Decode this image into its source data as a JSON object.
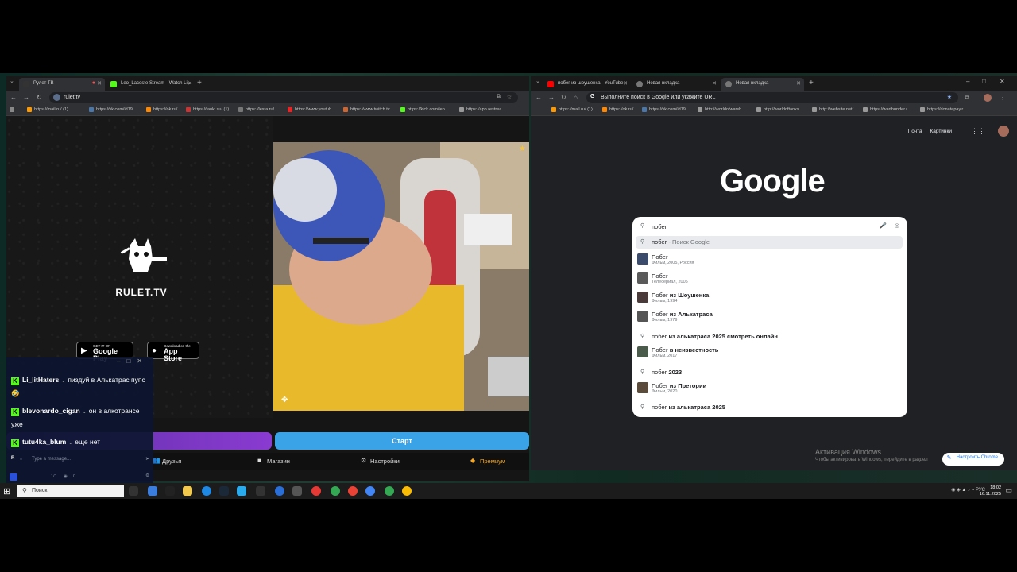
{
  "left_browser": {
    "tabs": [
      {
        "title": "Рулет ТВ",
        "active": true
      },
      {
        "title": "Leo_Lacoste Stream - Watch Li…",
        "active": false
      }
    ],
    "url": "rulet.tv",
    "bookmarks": [
      "https://mail.ru/ (1)",
      "https://vk.com/id19…",
      "https://ok.ru/",
      "https://tanki.su/ (1)",
      "https://lesta.ru/…",
      "https://www.youtub…",
      "https://www.twitch.tv…",
      "https://kick.com/leo…",
      "https://app.restrea…"
    ]
  },
  "rulet": {
    "brand": "RULET.TV",
    "google_play_small": "GET IT ON",
    "google_play_big": "Google Play",
    "app_store_small": "Download on the",
    "app_store_big": "App Store",
    "start_label": "Старт",
    "nav": {
      "friends": "Друзья",
      "shop": "Магазин",
      "settings": "Настройки",
      "premium": "Премиум"
    }
  },
  "chat": {
    "messages": [
      {
        "user": "Li_litHaters",
        "text": "пиздуй в Алькатрас пупс 🤣"
      },
      {
        "user": "blevonardo_cigan",
        "text": "он в алкотрансе уже"
      },
      {
        "user": "tutu4ka_blum",
        "text": "еще нет"
      }
    ],
    "input_avatar": "R",
    "input_placeholder": "Type a message...",
    "viewers": "1/1",
    "watchers": "0"
  },
  "right_browser": {
    "tabs": [
      {
        "title": "побег из шоушенка - YouTube",
        "active": false
      },
      {
        "title": "Новая вкладка",
        "active": false
      },
      {
        "title": "Новая вкладка",
        "active": true
      }
    ],
    "omnibox_placeholder": "Выполните поиск в Google или укажите URL",
    "bookmarks": [
      "https://mail.ru/ (1)",
      "https://ok.ru/",
      "https://vk.com/id19…",
      "http://worldofwarsh…",
      "http://worldoftanks…",
      "http://website.net/",
      "https://warthunder.r…",
      "https://donatepay.r…"
    ]
  },
  "google": {
    "logo": "Google",
    "mail_link": "Почта",
    "images_link": "Картинки",
    "query": "побег",
    "suggestions": [
      {
        "prefix": "побег",
        "bold": "",
        "sub": " - Поиск Google",
        "kind": "search"
      },
      {
        "prefix": "Побег",
        "bold": "",
        "sub": "Фильм, 2005, Россия",
        "kind": "entity"
      },
      {
        "prefix": "Побег",
        "bold": "",
        "sub": "Телесериал, 2005",
        "kind": "entity"
      },
      {
        "prefix": "Побег",
        "bold": " из Шоушенка",
        "sub": "Фильм, 1994",
        "kind": "entity"
      },
      {
        "prefix": "Побег",
        "bold": " из Алькатраса",
        "sub": "Фильм, 1979",
        "kind": "entity"
      },
      {
        "prefix": "побег",
        "bold": " из алькатраса 2025 смотреть онлайн",
        "sub": "",
        "kind": "search"
      },
      {
        "prefix": "Побег",
        "bold": " в неизвестность",
        "sub": "Фильм, 2017",
        "kind": "entity"
      },
      {
        "prefix": "побег",
        "bold": " 2023",
        "sub": "",
        "kind": "search"
      },
      {
        "prefix": "Побег",
        "bold": " из Претории",
        "sub": "Фильм, 2020",
        "kind": "entity"
      },
      {
        "prefix": "побег",
        "bold": " из алькатраса 2025",
        "sub": "",
        "kind": "search"
      }
    ],
    "activation_title": "Активация Windows",
    "activation_sub": "Чтобы активировать Windows, перейдите в раздел",
    "customize": "Настроить Chrome"
  },
  "taskbar": {
    "search_placeholder": "Поиск",
    "lang": "РУС",
    "time": "18:02",
    "date": "16.11.2025"
  }
}
